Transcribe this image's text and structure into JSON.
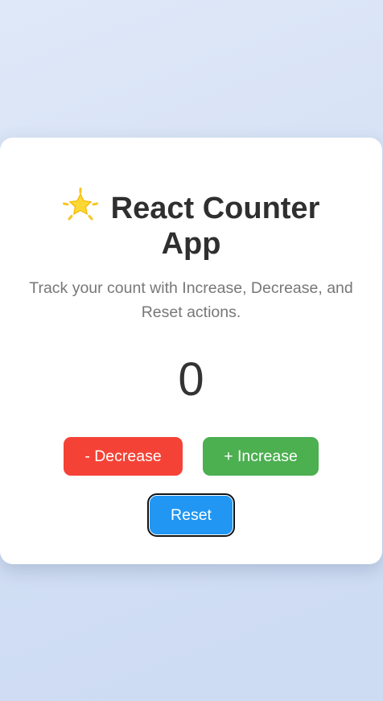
{
  "app": {
    "title": "React Counter App",
    "title_icon": "star-icon",
    "subtitle": "Track your count with Increase, Decrease, and Reset actions.",
    "count": "0"
  },
  "buttons": {
    "decrease_label": "- Decrease",
    "increase_label": "+ Increase",
    "reset_label": "Reset"
  },
  "colors": {
    "decrease": "#f44336",
    "increase": "#4caf50",
    "reset": "#2196f3",
    "star": "#fdd835"
  }
}
